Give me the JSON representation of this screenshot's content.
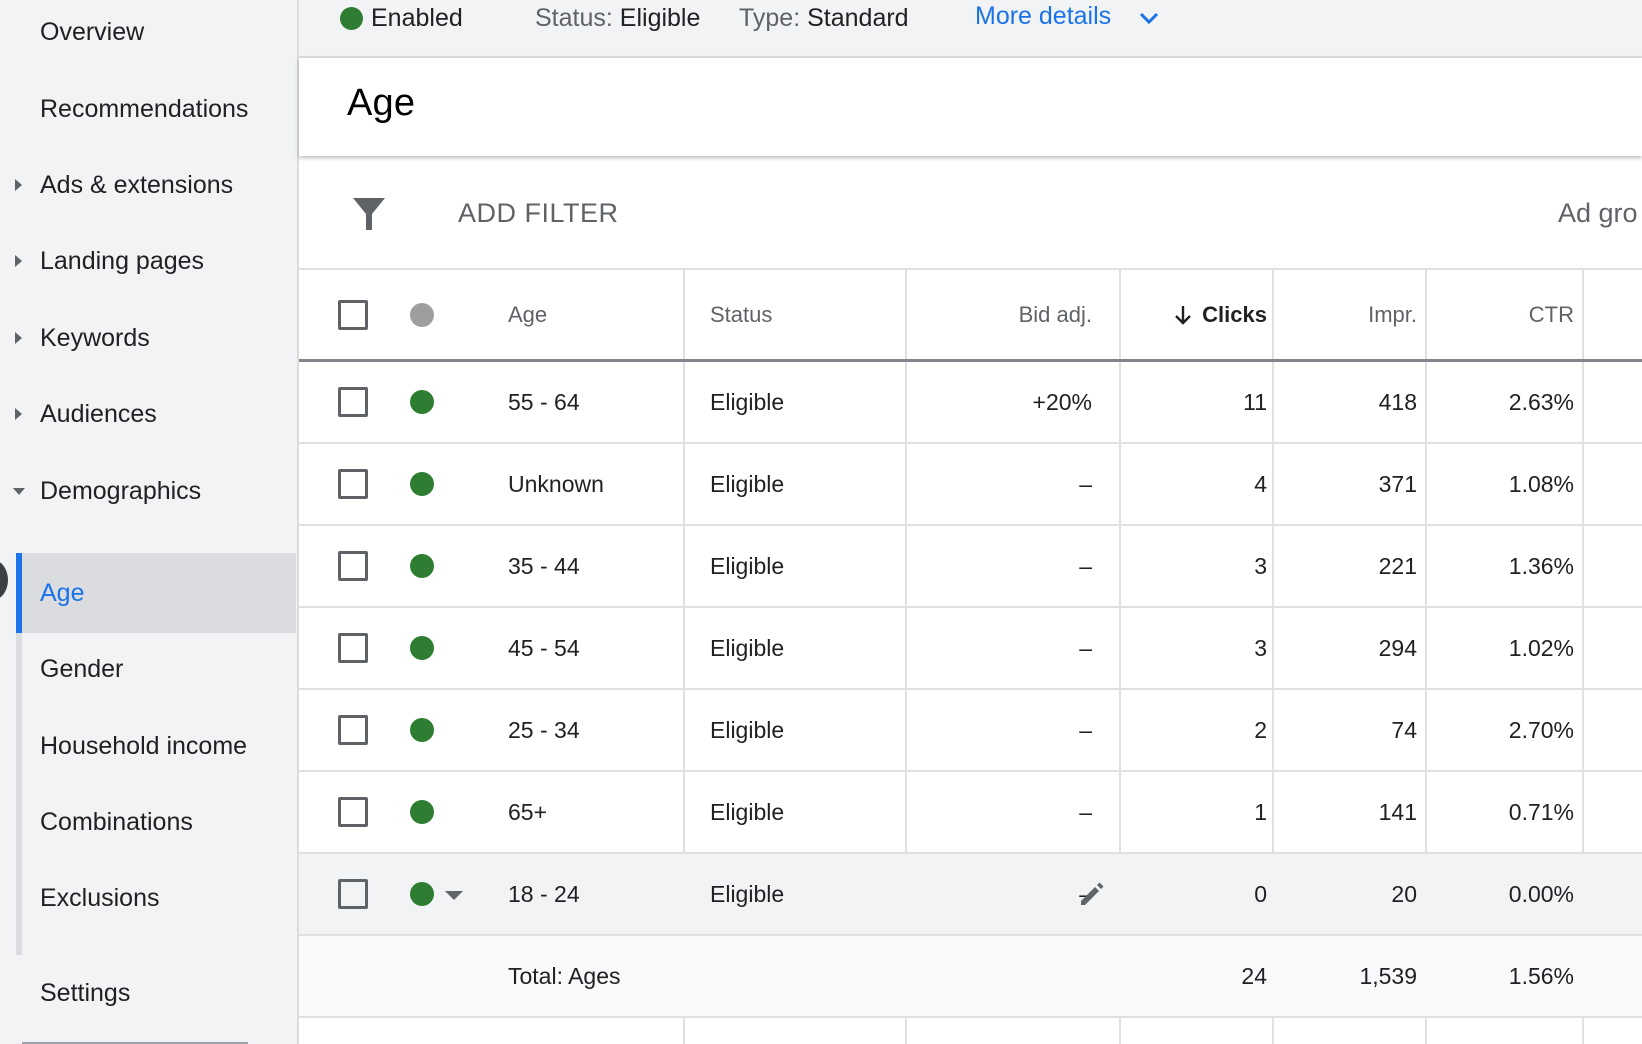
{
  "sidebar": {
    "items": [
      {
        "label": "Overview"
      },
      {
        "label": "Recommendations"
      },
      {
        "label": "Ads & extensions"
      },
      {
        "label": "Landing pages"
      },
      {
        "label": "Keywords"
      },
      {
        "label": "Audiences"
      },
      {
        "label": "Demographics"
      },
      {
        "label": "Age"
      },
      {
        "label": "Gender"
      },
      {
        "label": "Household income"
      },
      {
        "label": "Combinations"
      },
      {
        "label": "Exclusions"
      },
      {
        "label": "Settings"
      }
    ]
  },
  "topbar": {
    "enabled": "Enabled",
    "status_label": "Status:",
    "status_value": "Eligible",
    "type_label": "Type:",
    "type_value": "Standard",
    "more_details": "More details"
  },
  "page": {
    "title": "Age"
  },
  "filter": {
    "add_filter": "ADD FILTER",
    "right_label": "Ad gro"
  },
  "table": {
    "headers": {
      "age": "Age",
      "status": "Status",
      "bid": "Bid adj.",
      "clicks": "Clicks",
      "impr": "Impr.",
      "ctr": "CTR"
    },
    "rows": [
      {
        "age": "55 - 64",
        "status": "Eligible",
        "bid": "+20%",
        "clicks": "11",
        "impr": "418",
        "ctr": "2.63%"
      },
      {
        "age": "Unknown",
        "status": "Eligible",
        "bid": "–",
        "clicks": "4",
        "impr": "371",
        "ctr": "1.08%"
      },
      {
        "age": "35 - 44",
        "status": "Eligible",
        "bid": "–",
        "clicks": "3",
        "impr": "221",
        "ctr": "1.36%"
      },
      {
        "age": "45 - 54",
        "status": "Eligible",
        "bid": "–",
        "clicks": "3",
        "impr": "294",
        "ctr": "1.02%"
      },
      {
        "age": "25 - 34",
        "status": "Eligible",
        "bid": "–",
        "clicks": "2",
        "impr": "74",
        "ctr": "2.70%"
      },
      {
        "age": "65+",
        "status": "Eligible",
        "bid": "–",
        "clicks": "1",
        "impr": "141",
        "ctr": "0.71%"
      },
      {
        "age": "18 - 24",
        "status": "Eligible",
        "bid": "–",
        "clicks": "0",
        "impr": "20",
        "ctr": "0.00%"
      }
    ],
    "total": {
      "label": "Total: Ages",
      "clicks": "24",
      "impr": "1,539",
      "ctr": "1.56%"
    }
  },
  "colors": {
    "accent": "#1a73e8",
    "enabled_green": "#2e7d32"
  }
}
